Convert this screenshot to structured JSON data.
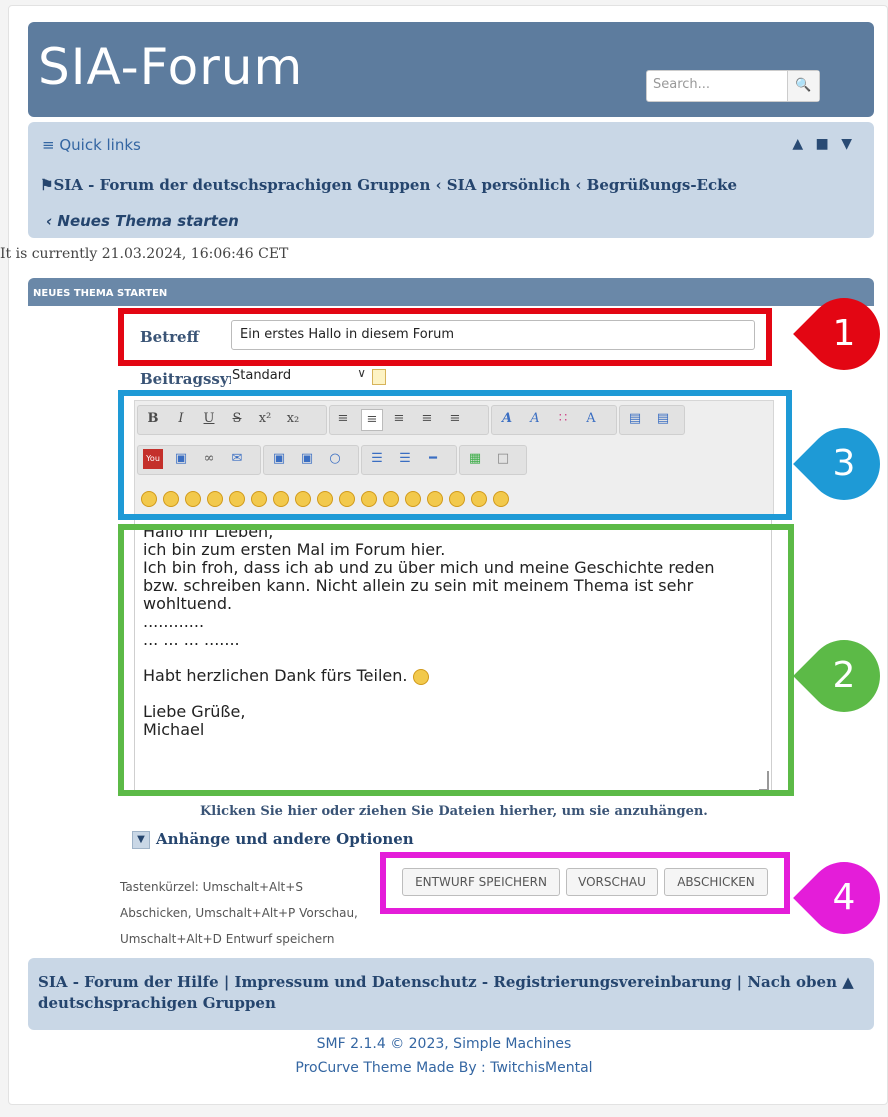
{
  "header": {
    "logo": "SIA-Forum",
    "search_placeholder": "Search...",
    "search_icon": "search-icon"
  },
  "nav": {
    "quick_links": "≡ Quick links",
    "icons": "▲ ■ ▼",
    "breadcrumb": "⚑SIA - Forum der deutschsprachigen Gruppen ‹ SIA persönlich ‹ Begrüßungs-Ecke",
    "breadcrumb_current": "‹ Neues Thema starten"
  },
  "current_time": "It is currently  21.03.2024, 16:06:46 CET",
  "section_title": "NEUES THEMA STARTEN",
  "form": {
    "subject_label": "Betreff",
    "subject_value": "Ein erstes Hallo in diesem Forum",
    "icon_label": "Beitragssymbol",
    "icon_select": "Standard"
  },
  "toolbar": {
    "row1": [
      "B",
      "I",
      "U",
      "S",
      "x²",
      "x₂",
      "≡",
      "≡",
      "≡",
      "≡",
      "≡",
      "A",
      "A",
      "∷",
      "A",
      "▤",
      "▤"
    ],
    "row2": [
      "You",
      "▣",
      "∞",
      "✉",
      "▣",
      "▣",
      "○",
      "☰",
      "☰",
      "━",
      "▦",
      "□"
    ],
    "smileys_count": 16
  },
  "editor": {
    "lines": [
      "Hallo ihr Lieben,",
      "ich bin zum ersten Mal im Forum hier.",
      "Ich bin froh, dass ich ab und zu über mich und meine Geschichte reden",
      "bzw. schreiben kann. Nicht allein zu sein mit meinem Thema ist sehr",
      "wohltuend.",
      "............",
      "... ... ... .......",
      "",
      "Habt herzlichen Dank fürs Teilen.",
      "",
      "Liebe Grüße,",
      "Michael"
    ]
  },
  "attachments": {
    "drop_text": "Klicken Sie hier oder ziehen Sie Dateien hierher, um sie anzuhängen.",
    "toggle": "Anhänge und andere Optionen"
  },
  "shortcuts": {
    "line1": "Tastenkürzel: Umschalt+Alt+S",
    "line2": "Abschicken, Umschalt+Alt+P Vorschau,",
    "line3": "Umschalt+Alt+D Entwurf speichern"
  },
  "buttons": {
    "save_draft": "ENTWURF SPEICHERN",
    "preview": "VORSCHAU",
    "submit": "ABSCHICKEN"
  },
  "footer": {
    "line1": "SIA - Forum der   Hilfe | Impressum und Datenschutz - Registrierungsvereinbarung | Nach oben ▲",
    "line2": "deutschsprachigen Gruppen",
    "smf": "SMF 2.1.4 © 2023, Simple Machines",
    "theme": "ProCurve Theme Made By : TwitchisMental"
  },
  "annotations": [
    {
      "number": "1",
      "color": "#e30613"
    },
    {
      "number": "2",
      "color": "#5cba47"
    },
    {
      "number": "3",
      "color": "#1e9ad6"
    },
    {
      "number": "4",
      "color": "#e41dd9"
    }
  ]
}
